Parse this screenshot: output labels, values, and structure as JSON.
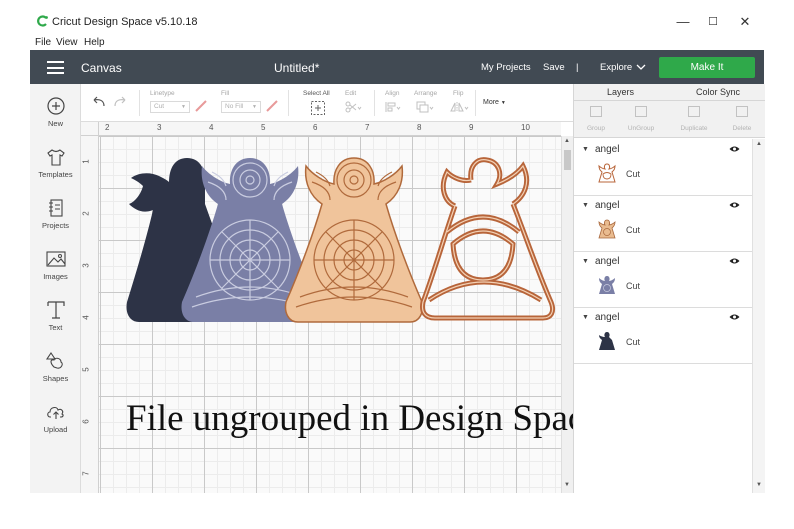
{
  "window": {
    "title": "Cricut Design Space  v5.10.18",
    "controls": {
      "minimize": "—",
      "maximize": "☐",
      "close": "✕"
    }
  },
  "menu": [
    "File",
    "View",
    "Help"
  ],
  "header": {
    "section": "Canvas",
    "doc_title": "Untitled*",
    "my_projects": "My Projects",
    "save": "Save",
    "separator": "|",
    "explore": "Explore",
    "make_it": "Make It"
  },
  "sidebar": [
    {
      "label": "New",
      "icon": "plus-circle-icon"
    },
    {
      "label": "Templates",
      "icon": "shirt-icon"
    },
    {
      "label": "Projects",
      "icon": "projects-icon"
    },
    {
      "label": "Images",
      "icon": "image-icon"
    },
    {
      "label": "Text",
      "icon": "text-t-icon"
    },
    {
      "label": "Shapes",
      "icon": "shapes-icon"
    },
    {
      "label": "Upload",
      "icon": "upload-cloud-icon"
    }
  ],
  "toolbar": {
    "linetype_label": "Linetype",
    "linetype_value": "Cut",
    "fill_label": "Fill",
    "fill_value": "No Fill",
    "select_all": "Select All",
    "edit": "Edit",
    "align": "Align",
    "arrange": "Arrange",
    "flip": "Flip",
    "more": "More"
  },
  "rulers": {
    "top": [
      "2",
      "3",
      "4",
      "5",
      "6",
      "7",
      "8",
      "9",
      "10"
    ],
    "left": [
      "1",
      "2",
      "3",
      "4",
      "5",
      "6",
      "7"
    ]
  },
  "canvas": {
    "caption": "File ungrouped in Design Space",
    "colors": {
      "navy": "#2d3346",
      "periwinkle": "#7a7fa6",
      "peach": "#f0c49b",
      "copper": "#b8653a"
    }
  },
  "panel": {
    "tabs": [
      "Layers",
      "Color Sync"
    ],
    "tools": [
      "Group",
      "UnGroup",
      "Duplicate",
      "Delete"
    ],
    "layers": [
      {
        "name": "angel",
        "operation": "Cut",
        "color": "#b8653a"
      },
      {
        "name": "angel",
        "operation": "Cut",
        "color": "#f0c49b"
      },
      {
        "name": "angel",
        "operation": "Cut",
        "color": "#7a7fa6"
      },
      {
        "name": "angel",
        "operation": "Cut",
        "color": "#2d3346"
      }
    ]
  }
}
